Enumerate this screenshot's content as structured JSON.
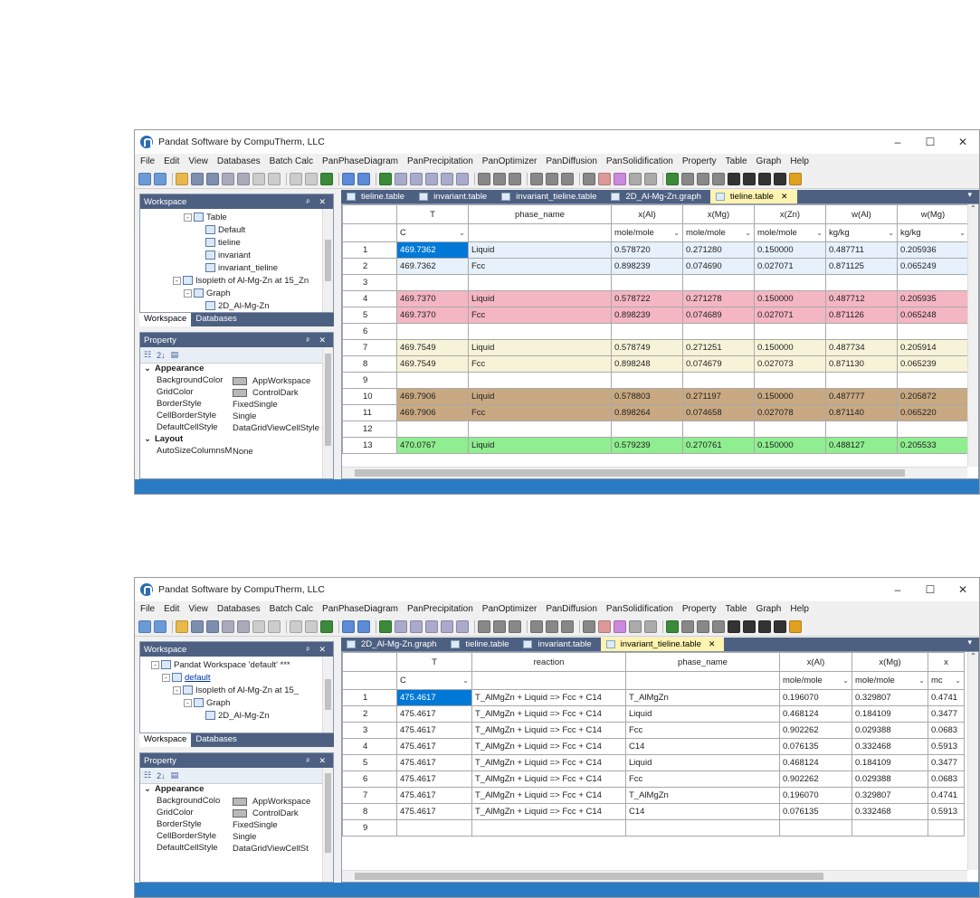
{
  "app_title": "Pandat Software by CompuTherm, LLC",
  "window_controls": {
    "minimize": "–",
    "maximize": "☐",
    "close": "✕"
  },
  "menu": [
    "File",
    "Edit",
    "View",
    "Databases",
    "Batch Calc",
    "PanPhaseDiagram",
    "PanPrecipitation",
    "PanOptimizer",
    "PanDiffusion",
    "PanSolidification",
    "Property",
    "Table",
    "Graph",
    "Help"
  ],
  "colors": {
    "panel_header": "#4d6082",
    "status_bar": "#2b7bc4",
    "active_tab": "#fff3b0",
    "row_pink": "#f4b6c2",
    "row_cream": "#f7f3d9",
    "row_tan": "#c8a982",
    "row_green": "#8fee90",
    "row_blue": "#e7f1fb",
    "selection": "#0078d7"
  },
  "panel_labels": {
    "workspace": "Workspace",
    "databases": "Databases",
    "property": "Property",
    "sort_az": "2↓"
  },
  "window1": {
    "tree": [
      {
        "label": "Table",
        "indent": 48,
        "icon": "table-icon",
        "exp": "-"
      },
      {
        "label": "Default",
        "indent": 72,
        "icon": "table-icon"
      },
      {
        "label": "tieline",
        "indent": 72,
        "icon": "table-icon"
      },
      {
        "label": "invariant",
        "indent": 72,
        "icon": "table-icon"
      },
      {
        "label": "invariant_tieline",
        "indent": 72,
        "icon": "table-icon"
      },
      {
        "label": "Isopleth of Al-Mg-Zn at 15_Zn",
        "indent": 36,
        "icon": "isopleth-icon",
        "exp": "-"
      },
      {
        "label": "Graph",
        "indent": 48,
        "icon": "graph-icon",
        "exp": "-"
      },
      {
        "label": "2D_Al-Mg-Zn",
        "indent": 72,
        "icon": "graph-icon"
      }
    ],
    "properties": [
      {
        "cat": true,
        "label": "Appearance"
      },
      {
        "k": "BackgroundColor",
        "v": "AppWorkspace",
        "swatch": true
      },
      {
        "k": "GridColor",
        "v": "ControlDark",
        "swatch": true
      },
      {
        "k": "BorderStyle",
        "v": "FixedSingle"
      },
      {
        "k": "CellBorderStyle",
        "v": "Single"
      },
      {
        "k": "DefaultCellStyle",
        "v": "DataGridViewCellStyle { B"
      },
      {
        "cat": true,
        "label": "Layout"
      },
      {
        "k": "AutoSizeColumnsM",
        "v": "None"
      }
    ],
    "tabs": [
      {
        "label": "tieline.table",
        "active": false
      },
      {
        "label": "invariant.table",
        "active": false
      },
      {
        "label": "invariant_tieline.table",
        "active": false
      },
      {
        "label": "2D_Al-Mg-Zn.graph",
        "active": false
      },
      {
        "label": "tieline.table",
        "active": true
      }
    ],
    "columns": [
      "T",
      "phase_name",
      "x(Al)",
      "x(Mg)",
      "x(Zn)",
      "w(Al)",
      "w(Mg)"
    ],
    "units": [
      "C",
      "",
      "mole/mole",
      "mole/mole",
      "mole/mole",
      "kg/kg",
      "kg/kg"
    ],
    "rows": [
      {
        "n": "1",
        "c": "blue",
        "v": [
          "469.7362",
          "Liquid",
          "0.578720",
          "0.271280",
          "0.150000",
          "0.487711",
          "0.205936"
        ]
      },
      {
        "n": "2",
        "c": "blue",
        "v": [
          "469.7362",
          "Fcc",
          "0.898239",
          "0.074690",
          "0.027071",
          "0.871125",
          "0.065249"
        ]
      },
      {
        "n": "3",
        "c": "",
        "v": [
          "",
          "",
          "",
          "",
          "",
          "",
          ""
        ]
      },
      {
        "n": "4",
        "c": "pink",
        "v": [
          "469.7370",
          "Liquid",
          "0.578722",
          "0.271278",
          "0.150000",
          "0.487712",
          "0.205935"
        ]
      },
      {
        "n": "5",
        "c": "pink",
        "v": [
          "469.7370",
          "Fcc",
          "0.898239",
          "0.074689",
          "0.027071",
          "0.871126",
          "0.065248"
        ]
      },
      {
        "n": "6",
        "c": "",
        "v": [
          "",
          "",
          "",
          "",
          "",
          "",
          ""
        ]
      },
      {
        "n": "7",
        "c": "cream",
        "v": [
          "469.7549",
          "Liquid",
          "0.578749",
          "0.271251",
          "0.150000",
          "0.487734",
          "0.205914"
        ]
      },
      {
        "n": "8",
        "c": "cream",
        "v": [
          "469.7549",
          "Fcc",
          "0.898248",
          "0.074679",
          "0.027073",
          "0.871130",
          "0.065239"
        ]
      },
      {
        "n": "9",
        "c": "",
        "v": [
          "",
          "",
          "",
          "",
          "",
          "",
          ""
        ]
      },
      {
        "n": "10",
        "c": "tan",
        "v": [
          "469.7906",
          "Liquid",
          "0.578803",
          "0.271197",
          "0.150000",
          "0.487777",
          "0.205872"
        ]
      },
      {
        "n": "11",
        "c": "tan",
        "v": [
          "469.7906",
          "Fcc",
          "0.898264",
          "0.074658",
          "0.027078",
          "0.871140",
          "0.065220"
        ]
      },
      {
        "n": "12",
        "c": "",
        "v": [
          "",
          "",
          "",
          "",
          "",
          "",
          ""
        ]
      },
      {
        "n": "13",
        "c": "green",
        "v": [
          "470.0767",
          "Liquid",
          "0.579239",
          "0.270761",
          "0.150000",
          "0.488127",
          "0.205533"
        ]
      }
    ]
  },
  "window2": {
    "tree": [
      {
        "label": "Pandat Workspace 'default' ***",
        "indent": 12,
        "icon": "workspace-icon",
        "exp": "-"
      },
      {
        "label": "default",
        "indent": 24,
        "icon": "folder-icon",
        "exp": "-",
        "link": true
      },
      {
        "label": "Isopleth of Al-Mg-Zn at 15_",
        "indent": 36,
        "icon": "isopleth-icon",
        "exp": "-"
      },
      {
        "label": "Graph",
        "indent": 48,
        "icon": "graph-icon",
        "exp": "-"
      },
      {
        "label": "2D_Al-Mg-Zn",
        "indent": 72,
        "icon": "graph-icon"
      }
    ],
    "properties": [
      {
        "cat": true,
        "label": "Appearance"
      },
      {
        "k": "BackgroundColo",
        "v": "AppWorkspace",
        "swatch": true
      },
      {
        "k": "GridColor",
        "v": "ControlDark",
        "swatch": true
      },
      {
        "k": "BorderStyle",
        "v": "FixedSingle"
      },
      {
        "k": "CellBorderStyle",
        "v": "Single"
      },
      {
        "k": "DefaultCellStyle",
        "v": "DataGridViewCellSt"
      }
    ],
    "tabs": [
      {
        "label": "2D_Al-Mg-Zn.graph",
        "active": false
      },
      {
        "label": "tieline.table",
        "active": false
      },
      {
        "label": "invariant.table",
        "active": false
      },
      {
        "label": "invariant_tieline.table",
        "active": true
      }
    ],
    "columns": [
      "T",
      "reaction",
      "phase_name",
      "x(Al)",
      "x(Mg)",
      "x"
    ],
    "units": [
      "C",
      "",
      "",
      "mole/mole",
      "mole/mole",
      "mc"
    ],
    "rows": [
      {
        "n": "1",
        "v": [
          "475.4617",
          "T_AlMgZn + Liquid => Fcc + C14",
          "T_AlMgZn",
          "0.196070",
          "0.329807",
          "0.4741"
        ]
      },
      {
        "n": "2",
        "v": [
          "475.4617",
          "T_AlMgZn + Liquid => Fcc + C14",
          "Liquid",
          "0.468124",
          "0.184109",
          "0.3477"
        ]
      },
      {
        "n": "3",
        "v": [
          "475.4617",
          "T_AlMgZn + Liquid => Fcc + C14",
          "Fcc",
          "0.902262",
          "0.029388",
          "0.0683"
        ]
      },
      {
        "n": "4",
        "v": [
          "475.4617",
          "T_AlMgZn + Liquid => Fcc + C14",
          "C14",
          "0.076135",
          "0.332468",
          "0.5913"
        ]
      },
      {
        "n": "5",
        "v": [
          "475.4617",
          "T_AlMgZn + Liquid => Fcc + C14",
          "Liquid",
          "0.468124",
          "0.184109",
          "0.3477"
        ]
      },
      {
        "n": "6",
        "v": [
          "475.4617",
          "T_AlMgZn + Liquid => Fcc + C14",
          "Fcc",
          "0.902262",
          "0.029388",
          "0.0683"
        ]
      },
      {
        "n": "7",
        "v": [
          "475.4617",
          "T_AlMgZn + Liquid => Fcc + C14",
          "T_AlMgZn",
          "0.196070",
          "0.329807",
          "0.4741"
        ]
      },
      {
        "n": "8",
        "v": [
          "475.4617",
          "T_AlMgZn + Liquid => Fcc + C14",
          "C14",
          "0.076135",
          "0.332468",
          "0.5913"
        ]
      },
      {
        "n": "9",
        "v": [
          "",
          "",
          "",
          "",
          "",
          ""
        ]
      }
    ]
  }
}
